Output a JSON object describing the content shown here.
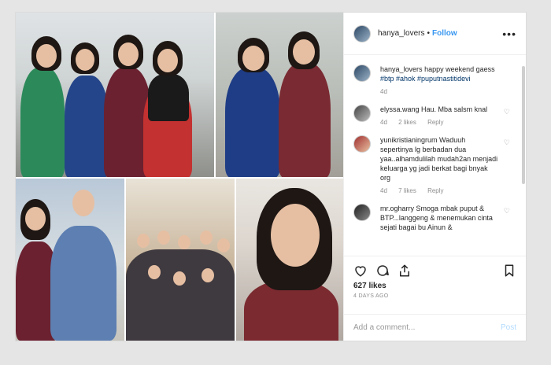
{
  "header": {
    "username": "hanya_lovers",
    "separator": "•",
    "follow_label": "Follow",
    "more_icon": "more-horizontal-icon"
  },
  "caption": {
    "username": "hanya_lovers",
    "text": "happy weekend gaess",
    "hashtags": "#btp #ahok #puputnastitidevi",
    "age": "4d"
  },
  "comments": [
    {
      "username": "elyssa.wang",
      "text": "Hau. Mba salsm knal",
      "age": "4d",
      "likes": "2 likes",
      "reply": "Reply"
    },
    {
      "username": "yunikristianingrum",
      "text": "Waduuh sepertinya lg berbadan dua yaa..alhamdulilah mudah2an menjadi keluarga yg jadi berkat bagi bnyak org",
      "age": "4d",
      "likes": "7 likes",
      "reply": "Reply"
    },
    {
      "username": "mr.ogharry",
      "text": "Smoga mbak puput & BTP...langgeng & menemukan cinta sejati bagai bu Ainun &",
      "age": "",
      "likes": "",
      "reply": ""
    }
  ],
  "actions": {
    "likes": "627 likes",
    "date": "4 DAYS AGO"
  },
  "add_comment": {
    "placeholder": "Add a comment...",
    "post_label": "Post"
  },
  "colors": {
    "link": "#3897f0",
    "text": "#262626",
    "muted": "#8e8e8e"
  }
}
